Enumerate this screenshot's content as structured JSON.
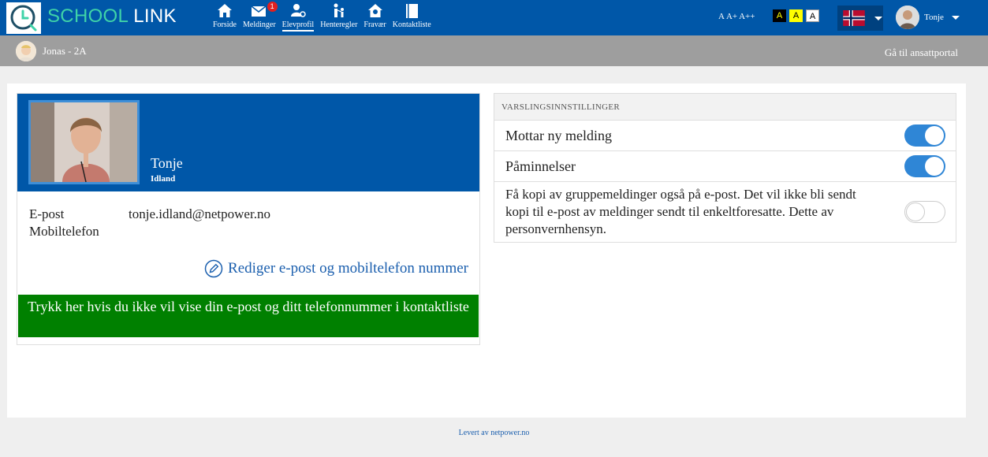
{
  "app": {
    "brand_first": "SCHOOL",
    "brand_second": " LINK"
  },
  "nav": {
    "items": [
      {
        "label": "Forside",
        "icon": "home-icon"
      },
      {
        "label": "Meldinger",
        "icon": "envelope-icon",
        "badge": "1"
      },
      {
        "label": "Elevprofil",
        "icon": "student-profile-icon",
        "active": true
      },
      {
        "label": "Henteregler",
        "icon": "pickup-rules-icon"
      },
      {
        "label": "Fravær",
        "icon": "absence-house-icon"
      },
      {
        "label": "Kontaktliste",
        "icon": "contact-book-icon"
      }
    ]
  },
  "accessibility": {
    "font_sizes": [
      "A",
      "A+",
      "A++"
    ],
    "contrast": [
      "A",
      "A",
      "A"
    ]
  },
  "user": {
    "name": "Tonje"
  },
  "subbar": {
    "child": "Jonas - 2A",
    "staff_portal": "Gå til ansattportal"
  },
  "profile": {
    "first_name": "Tonje",
    "last_name": "Idland",
    "email_label": "E-post",
    "email_value": "tonje.idland@netpower.no",
    "phone_label": "Mobiltelefon",
    "phone_value": "",
    "edit_link": "Rediger e-post og mobiltelefon nummer",
    "hide_button": "Trykk her hvis du ikke vil vise din e-post og ditt telefonnummer i kontaktliste"
  },
  "notifications": {
    "heading": "VARSLINGSINNSTILLINGER",
    "settings": [
      {
        "label": "Mottar ny melding",
        "enabled": true
      },
      {
        "label": "Påminnelser",
        "enabled": true
      },
      {
        "label": "Få kopi av gruppemeldinger også på e-post. Det vil ikke bli sendt kopi til e-post av meldinger sendt til enkeltforesatte. Dette av personvernhensyn.",
        "enabled": false
      }
    ]
  },
  "footer": {
    "text": "Levert av netpower.no"
  },
  "colors": {
    "primary": "#0057a8",
    "accent": "#3fd3a8",
    "subbar": "#9e9e9e",
    "toggle_on": "#2f86d6",
    "hide_button": "#008000",
    "badge": "#e02020"
  }
}
